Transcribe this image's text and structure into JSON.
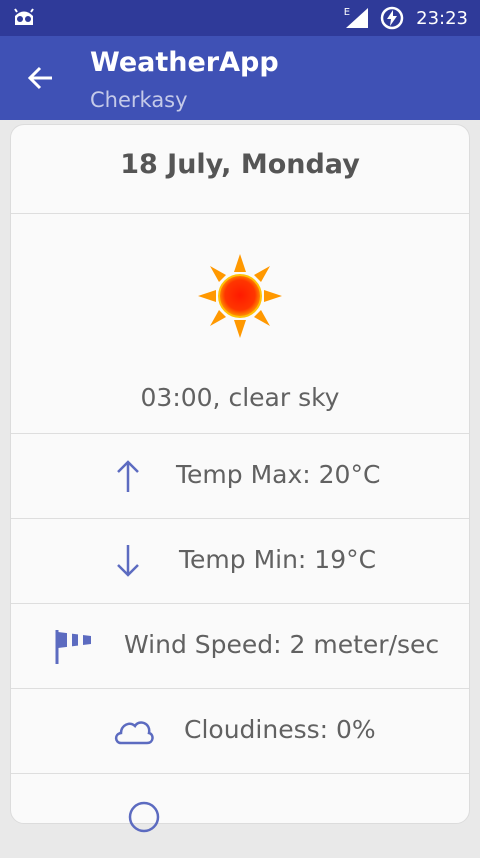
{
  "status_bar": {
    "network": "E",
    "time": "23:23",
    "icons": [
      "android-robot-icon",
      "signal-icon",
      "battery-charging-icon"
    ]
  },
  "app_bar": {
    "title": "WeatherApp",
    "subtitle": "Cherkasy",
    "back_icon": "arrow-left-icon"
  },
  "forecast": {
    "date": "18 July, Monday",
    "weather_icon": "sun-icon",
    "description": "03:00, clear sky",
    "metrics": [
      {
        "icon": "arrow-up-icon",
        "label": "Temp Max: 20°C"
      },
      {
        "icon": "arrow-down-icon",
        "label": "Temp Min: 19°C"
      },
      {
        "icon": "windsock-icon",
        "label": "Wind Speed: 2 meter/sec"
      },
      {
        "icon": "cloud-icon",
        "label": "Cloudiness: 0%"
      }
    ]
  },
  "colors": {
    "status_bar": "#2f3a99",
    "app_bar": "#3f51b5",
    "subtitle": "#c5cae9",
    "icon_tint": "#5c6bc0",
    "card_background": "#fafafa",
    "text": "#616161"
  }
}
